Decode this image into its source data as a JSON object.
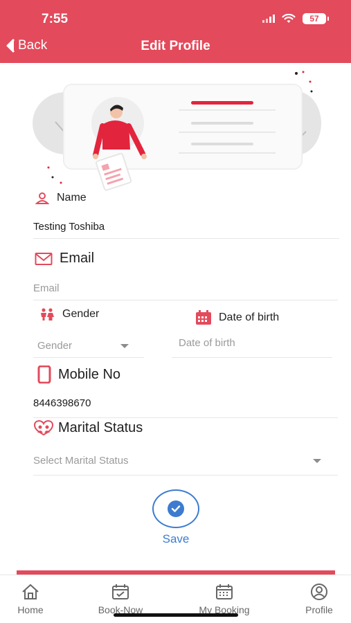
{
  "status_bar": {
    "time": "7:55",
    "battery": "57"
  },
  "header": {
    "back_label": "Back",
    "title": "Edit Profile"
  },
  "colors": {
    "brand": "#e34a5b",
    "accent_blue": "#3c7bd0"
  },
  "form": {
    "name": {
      "label": "Name",
      "value": "Testing Toshiba"
    },
    "email": {
      "label": "Email",
      "placeholder": "Email"
    },
    "gender": {
      "label": "Gender",
      "placeholder": "Gender"
    },
    "dob": {
      "label": "Date of birth",
      "placeholder": "Date of birth"
    },
    "mobile": {
      "label": "Mobile No",
      "value": "8446398670"
    },
    "marital": {
      "label": "Marital Status",
      "placeholder": "Select Marital Status"
    }
  },
  "save_label": "Save",
  "bottom_nav": {
    "items": [
      {
        "label": "Home",
        "icon": "home-icon"
      },
      {
        "label": "Book-Now",
        "icon": "calendar-check-icon"
      },
      {
        "label": "My Booking",
        "icon": "calendar-grid-icon"
      },
      {
        "label": "Profile",
        "icon": "user-circle-icon"
      }
    ]
  }
}
